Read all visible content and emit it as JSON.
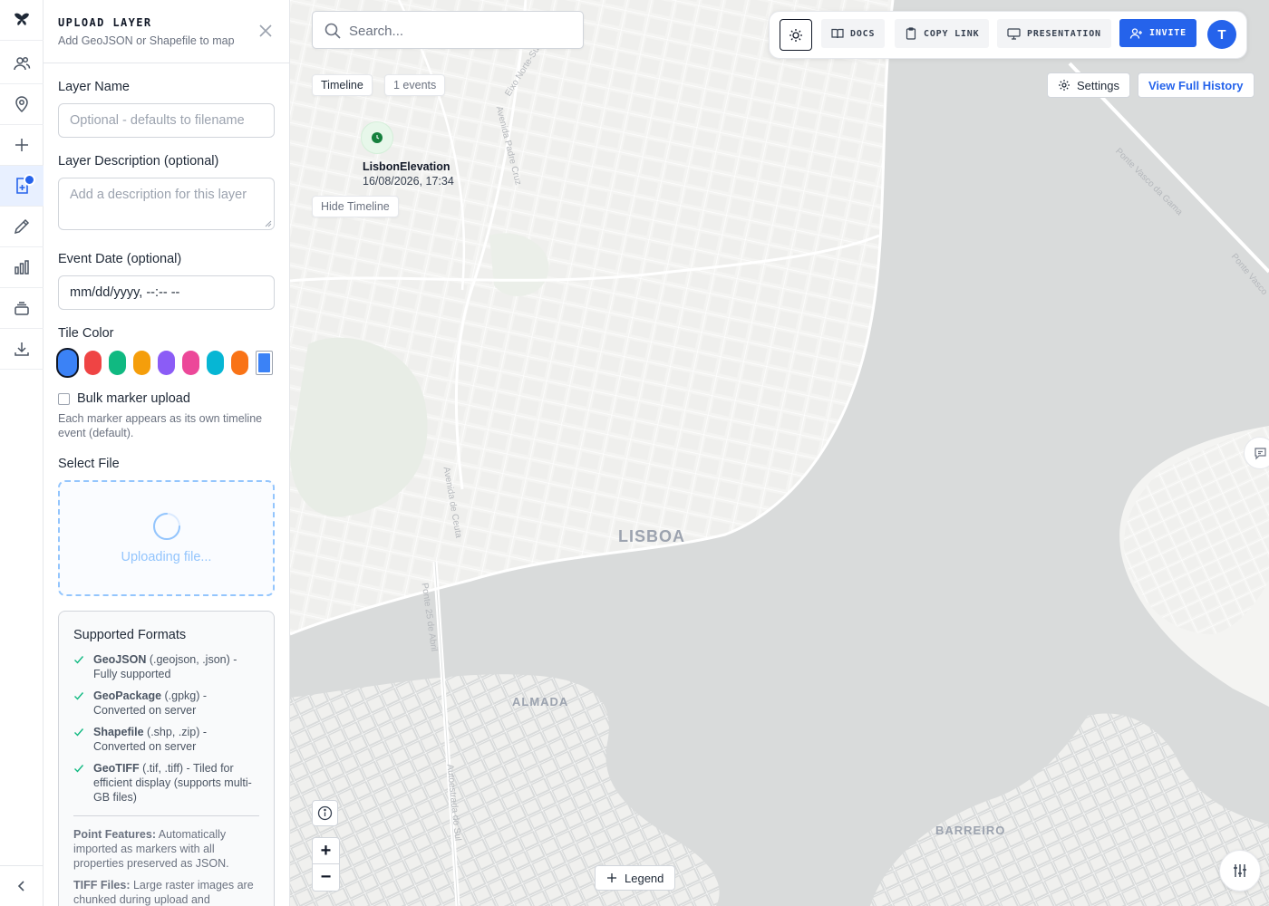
{
  "panel": {
    "title": "UPLOAD LAYER",
    "subtitle": "Add GeoJSON or Shapefile to map",
    "layer_name_label": "Layer Name",
    "layer_name_placeholder": "Optional - defaults to filename",
    "description_label": "Layer Description (optional)",
    "description_placeholder": "Add a description for this layer",
    "event_date_label": "Event Date (optional)",
    "event_date_value": "mm/dd/yyyy, --:-- --",
    "tile_color_label": "Tile Color",
    "tile_colors": [
      "#3b82f6",
      "#ef4444",
      "#10b981",
      "#f59e0b",
      "#8b5cf6",
      "#ec4899",
      "#06b6d4",
      "#f97316"
    ],
    "selected_color": "#3b82f6",
    "custom_color": "#3b82f6",
    "bulk_label": "Bulk marker upload",
    "bulk_checked": false,
    "bulk_hint": "Each marker appears as its own timeline event (default).",
    "select_file_label": "Select File",
    "uploading_text": "Uploading file...",
    "formats_title": "Supported Formats",
    "formats": [
      {
        "name": "GeoJSON",
        "detail": " (.geojson, .json) - Fully supported"
      },
      {
        "name": "GeoPackage",
        "detail": " (.gpkg) - Converted on server"
      },
      {
        "name": "Shapefile",
        "detail": " (.shp, .zip) - Converted on server"
      },
      {
        "name": "GeoTIFF",
        "detail": " (.tif, .tiff) - Tiled for efficient display (supports multi-GB files)"
      }
    ],
    "notes": [
      {
        "title": "Point Features:",
        "text": " Automatically imported as markers with all properties preserved as JSON."
      },
      {
        "title": "TIFF Files:",
        "text": " Large raster images are chunked during upload and"
      }
    ]
  },
  "map": {
    "search_placeholder": "Search...",
    "toolbar": {
      "docs": "DOCS",
      "copy_link": "COPY LINK",
      "presentation": "PRESENTATION",
      "invite": "INVITE",
      "avatar_initial": "T"
    },
    "timeline_label": "Timeline",
    "events_count": "1 events",
    "event_name": "LisbonElevation",
    "event_date": "16/08/2026, 17:34",
    "hide_timeline": "Hide Timeline",
    "settings_label": "Settings",
    "history_label": "View Full History",
    "legend_label": "Legend",
    "zoom_in": "+",
    "zoom_out": "−",
    "place_labels": [
      "LISBOA",
      "ALMADA",
      "BARREIRO"
    ],
    "street_labels": [
      "Ponte Vasco da Gama",
      "Ponte Vasco",
      "Avenida Padre Cruz",
      "Eixo Norte-Sul",
      "Avenida de Ceuta",
      "Ponte 25 de Abril",
      "Autoestrada do Sul"
    ]
  }
}
